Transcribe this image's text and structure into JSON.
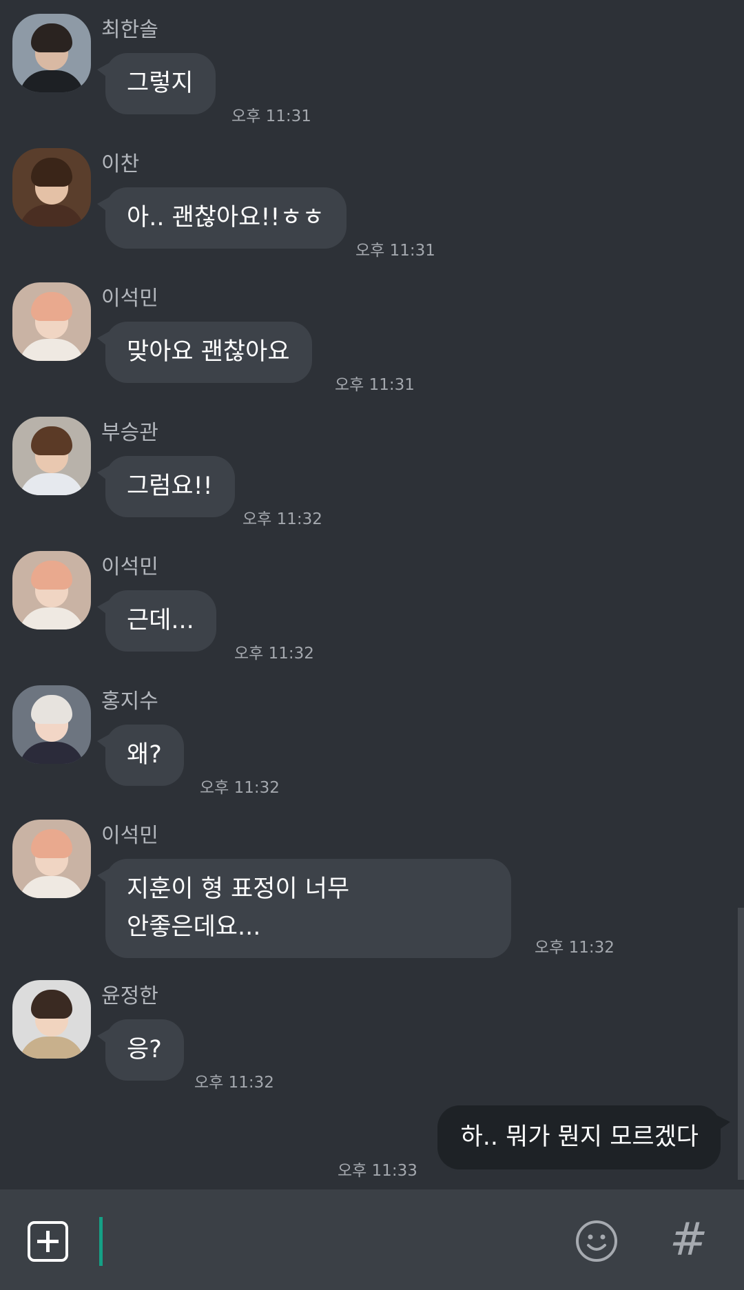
{
  "messages": [
    {
      "sender": "최한솔",
      "text": "그렇지",
      "time": "오후 11:31"
    },
    {
      "sender": "이찬",
      "text": "아.. 괜찮아요!!ㅎㅎ",
      "time": "오후 11:31"
    },
    {
      "sender": "이석민",
      "text": "맞아요 괜찮아요",
      "time": "오후 11:31"
    },
    {
      "sender": "부승관",
      "text": "그럼요!!",
      "time": "오후 11:32"
    },
    {
      "sender": "이석민",
      "text": "근데...",
      "time": "오후 11:32"
    },
    {
      "sender": "홍지수",
      "text": "왜?",
      "time": "오후 11:32"
    },
    {
      "sender": "이석민",
      "text": "지훈이 형 표정이 너무\n안좋은데요...",
      "time": "오후 11:32"
    },
    {
      "sender": "윤정한",
      "text": "응?",
      "time": "오후 11:32"
    }
  ],
  "my_message": {
    "text": "하.. 뭐가 뭔지 모르겠다",
    "time": "오후 11:33"
  },
  "input_bar": {
    "add_icon": "plus-square-icon",
    "emoji_icon": "smiley-icon",
    "hash_icon": "hash-icon",
    "hash_glyph": "#",
    "input_value": ""
  },
  "colors": {
    "background": "#2d3137",
    "bubble_other": "#3d4249",
    "bubble_mine": "#1e2226",
    "input_bar": "#3b4046",
    "cursor": "#15a085"
  }
}
